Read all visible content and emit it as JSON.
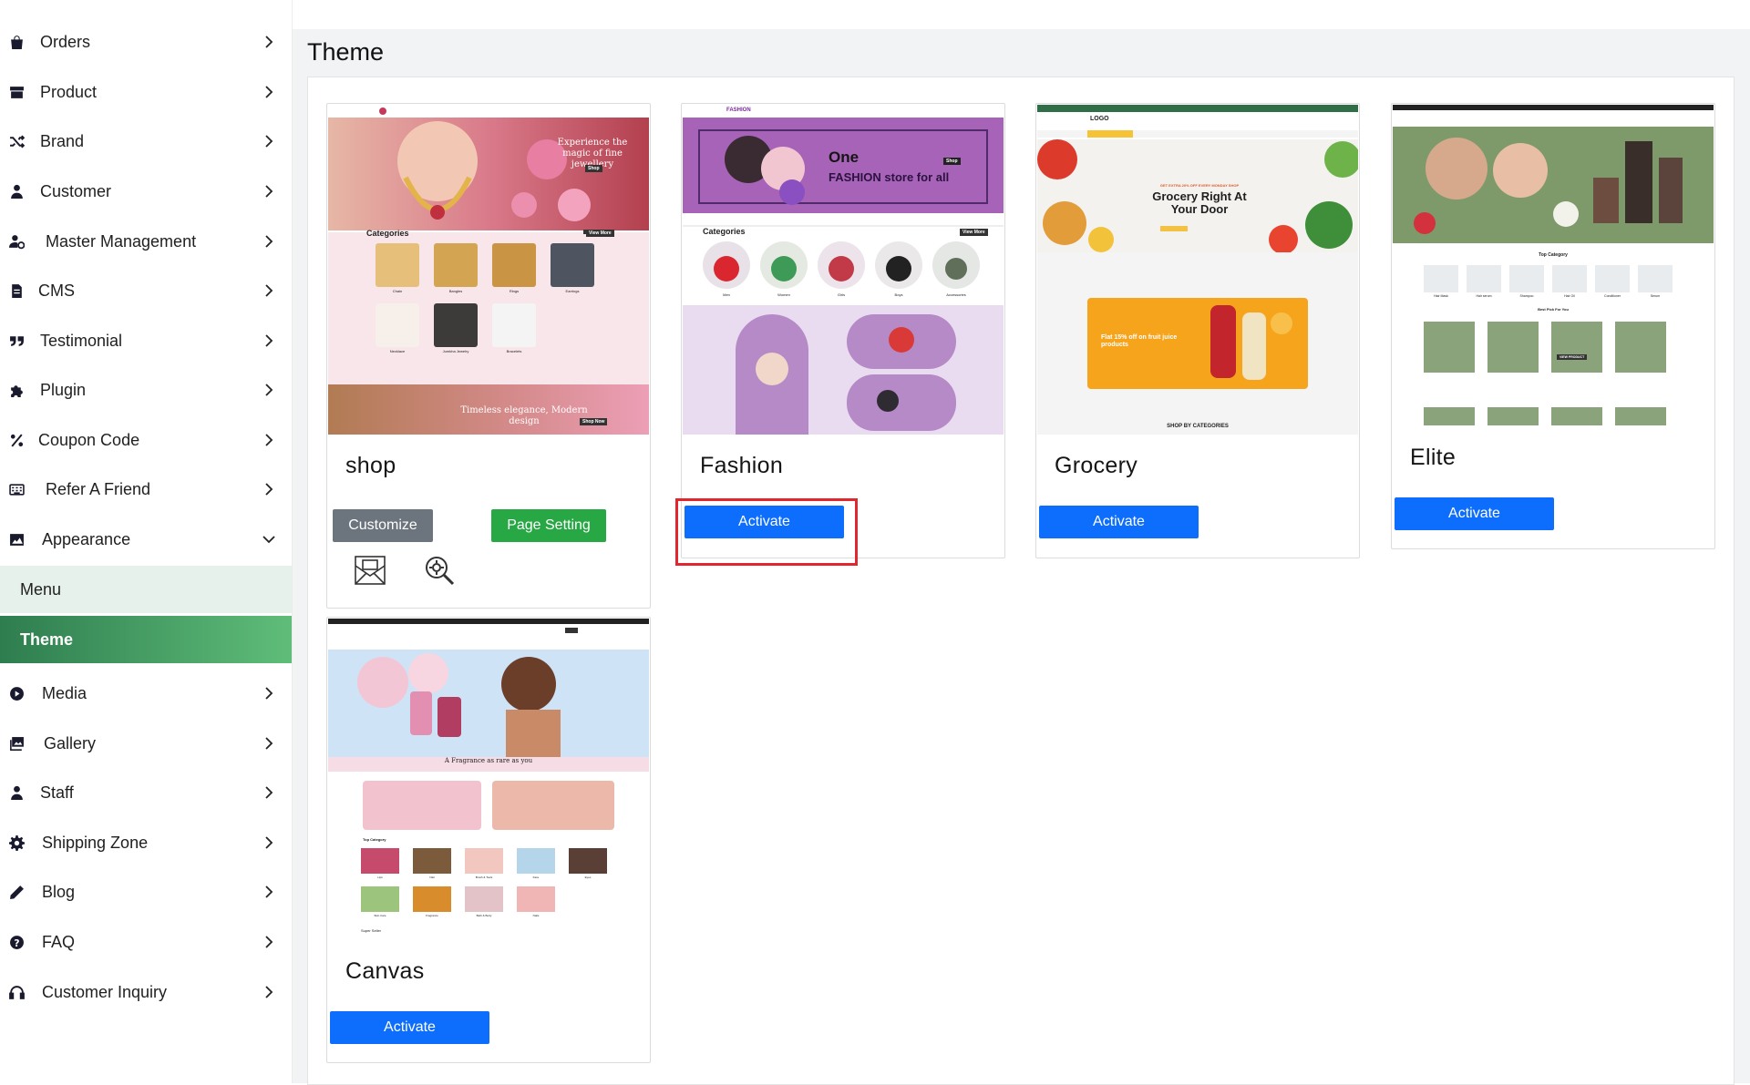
{
  "sidebar": {
    "items": [
      {
        "label": "Orders",
        "icon": "bag-icon"
      },
      {
        "label": "Product",
        "icon": "archive-icon"
      },
      {
        "label": "Brand",
        "icon": "shuffle-icon"
      },
      {
        "label": "Customer",
        "icon": "user-icon"
      },
      {
        "label": "Master Management",
        "icon": "user-cog-icon"
      },
      {
        "label": "CMS",
        "icon": "file-icon"
      },
      {
        "label": "Testimonial",
        "icon": "quote-icon"
      },
      {
        "label": "Plugin",
        "icon": "puzzle-icon"
      },
      {
        "label": "Coupon Code",
        "icon": "percent-icon"
      },
      {
        "label": "Refer A Friend",
        "icon": "keyboard-icon"
      },
      {
        "label": "Appearance",
        "icon": "image-icon"
      },
      {
        "label": "Media",
        "icon": "play-circle-icon"
      },
      {
        "label": "Gallery",
        "icon": "images-icon"
      },
      {
        "label": "Staff",
        "icon": "user-icon"
      },
      {
        "label": "Shipping Zone",
        "icon": "gear-icon"
      },
      {
        "label": "Blog",
        "icon": "pencil-icon"
      },
      {
        "label": "FAQ",
        "icon": "question-circle-icon"
      },
      {
        "label": "Customer Inquiry",
        "icon": "headset-icon"
      }
    ],
    "appearance_sub": {
      "menu": "Menu",
      "theme": "Theme"
    }
  },
  "main": {
    "page_title": "Theme",
    "themes": [
      {
        "name": "shop",
        "buttons": {
          "customize": "Customize",
          "page_setting": "Page Setting"
        },
        "preview": {
          "hero": "Experience the magic of fine jewellery",
          "shop": "Shop",
          "categories": "Categories",
          "view_more": "View More",
          "tiles": [
            "Chain",
            "Bangles",
            "Rings",
            "Earrings",
            "Necklace",
            "Jumkha Jewelry",
            "Bracelets"
          ],
          "banner": "Timeless elegance, Modern design",
          "banner_btn": "Shop Now"
        }
      },
      {
        "name": "Fashion",
        "buttons": {
          "activate": "Activate"
        },
        "preview": {
          "logo": "FASHION",
          "hero_one": "One",
          "hero_line": "FASHION store for all",
          "shop": "Shop",
          "categories": "Categories",
          "view_more": "View More",
          "tiles": [
            "Men",
            "Women",
            "Girls",
            "Boys",
            "Accessories"
          ]
        }
      },
      {
        "name": "Grocery",
        "buttons": {
          "activate": "Activate"
        },
        "preview": {
          "logo": "LOGO",
          "promo": "GET EXTRA 20% OFF EVERY MONDAY SHOP",
          "headline": "Grocery Right At Your Door",
          "offer": "Flat 15% off on fruit juice products",
          "section": "SHOP BY CATEGORIES"
        }
      },
      {
        "name": "Elite",
        "buttons": {
          "activate": "Activate"
        },
        "preview": {
          "section": "Top Category",
          "tiles": [
            "Hair Mask",
            "Hair serum",
            "Shampoo",
            "Hair Oil",
            "Conditioner",
            "Serum"
          ],
          "section2": "Best Pick For You",
          "badge": "VIEW PRODUCT"
        }
      },
      {
        "name": "Canvas",
        "buttons": {
          "activate": "Activate"
        },
        "preview": {
          "tagline": "A Fragrance as rare as you",
          "section": "Top Category",
          "tiles": [
            "Lips",
            "Nail",
            "Brush & Tools",
            "Face",
            "Eyes",
            "Skin Care",
            "Fragrance",
            "Bath & Body",
            "Nails"
          ],
          "section2": "Super Seller"
        }
      }
    ]
  },
  "colors": {
    "accent_green": "#2e7d4f",
    "button_blue": "#0d6efd",
    "button_green": "#28a745",
    "button_grey": "#6c757d",
    "highlight_red": "#e3262d"
  }
}
